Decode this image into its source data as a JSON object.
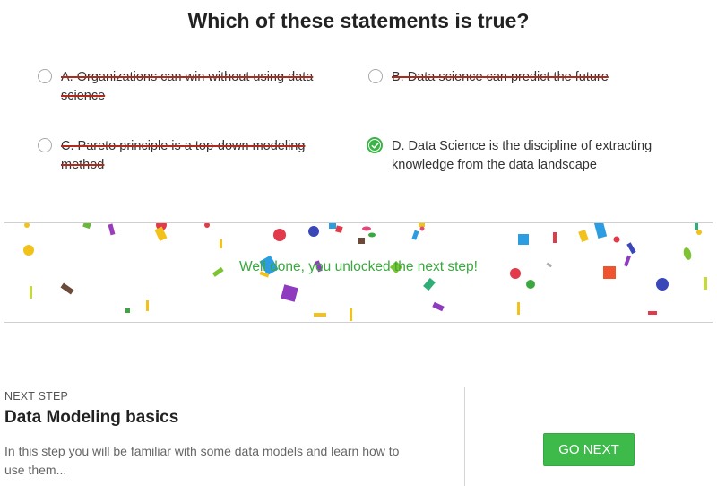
{
  "question": "Which of these statements is true?",
  "options": [
    {
      "text": "A. Organizations can win without using data science",
      "struck": true,
      "selected": false
    },
    {
      "text": "B. Data science can predict the future",
      "struck": true,
      "selected": false
    },
    {
      "text": "C. Pareto principle is a top-down modeling method",
      "struck": true,
      "selected": false
    },
    {
      "text": "D. Data Science is the discipline of extracting knowledge from the data landscape",
      "struck": false,
      "selected": true
    }
  ],
  "result": {
    "message": "Well done, you unlocked the next step!"
  },
  "next_step": {
    "kicker": "NEXT STEP",
    "title": "Data Modeling basics",
    "description": "In this step you will be familiar with some data models and learn how to use them...",
    "button_label": "GO NEXT"
  },
  "colors": {
    "accent_green": "#3dba4a",
    "strike_red": "#b22a1e"
  },
  "icons": {
    "selected_radio": "check-icon"
  }
}
